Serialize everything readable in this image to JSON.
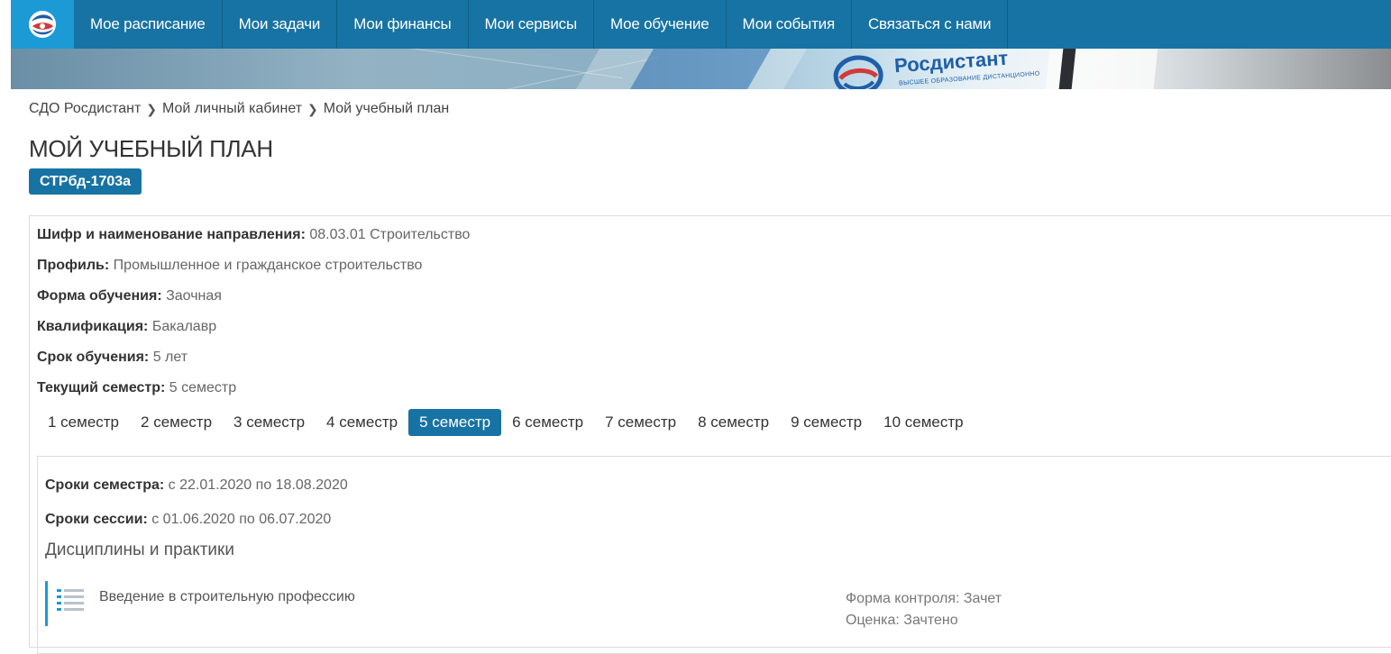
{
  "nav": {
    "items": [
      {
        "label": "Мое расписание"
      },
      {
        "label": "Мои задачи"
      },
      {
        "label": "Мои финансы"
      },
      {
        "label": "Мои сервисы"
      },
      {
        "label": "Мое обучение"
      },
      {
        "label": "Мои события"
      },
      {
        "label": "Связаться с нами"
      }
    ]
  },
  "banner": {
    "brand": "Росдистант",
    "tagline": "ВЫСШЕЕ ОБРАЗОВАНИЕ ДИСТАНЦИОННО"
  },
  "breadcrumb": [
    {
      "label": "СДО Росдистант"
    },
    {
      "label": "Мой личный кабинет"
    },
    {
      "label": "Мой учебный план"
    }
  ],
  "page": {
    "title": "МОЙ УЧЕБНЫЙ ПЛАН",
    "group": "СТРбд-1703а"
  },
  "info": [
    {
      "label": "Шифр и наименование направления:",
      "value": " 08.03.01 Строительство"
    },
    {
      "label": "Профиль:",
      "value": " Промышленное и гражданское строительство"
    },
    {
      "label": "Форма обучения:",
      "value": " Заочная"
    },
    {
      "label": "Квалификация:",
      "value": " Бакалавр"
    },
    {
      "label": "Срок обучения:",
      "value": " 5 лет"
    },
    {
      "label": "Текущий семестр:",
      "value": " 5 семестр"
    }
  ],
  "semesters": [
    {
      "label": "1 семестр"
    },
    {
      "label": "2 семестр"
    },
    {
      "label": "3 семестр"
    },
    {
      "label": "4 семестр"
    },
    {
      "label": "5 семестр",
      "active": true
    },
    {
      "label": "6 семестр"
    },
    {
      "label": "7 семестр"
    },
    {
      "label": "8 семестр"
    },
    {
      "label": "9 семестр"
    },
    {
      "label": "10 семестр"
    }
  ],
  "semester_detail": {
    "period_label": "Сроки семестра:",
    "period_value": " с 22.01.2020 по 18.08.2020",
    "session_label": "Сроки сессии:",
    "session_value": " с 01.06.2020 по 06.07.2020",
    "section_title": "Дисциплины и практики",
    "disciplines": [
      {
        "name": "Введение в строительную профессию",
        "control": "Форма контроля: Зачет",
        "grade": "Оценка: Зачтено"
      }
    ]
  },
  "colors": {
    "nav_bg": "#1773a3",
    "logo_bg": "#1b9ad6",
    "accent": "#1773a3"
  }
}
